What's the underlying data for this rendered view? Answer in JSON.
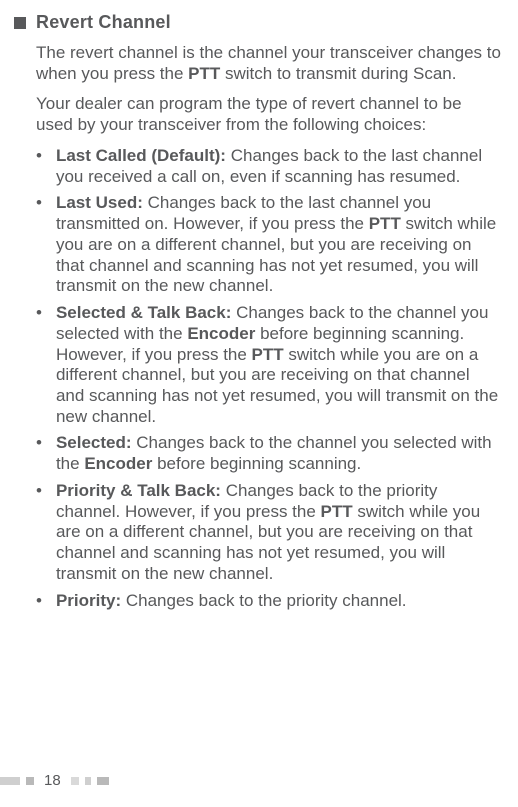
{
  "section": {
    "title": "Revert Channel"
  },
  "intro": {
    "p1_a": "The revert channel is the channel your transceiver changes to when you press the ",
    "p1_b": "PTT",
    "p1_c": " switch to transmit during Scan.",
    "p2": "Your dealer can program the type of revert channel to be used by your transceiver from the following choices:"
  },
  "items": {
    "b0_term": "Last Called (Default):",
    "b0_text": "  Changes back to the last channel you received a call on, even if scanning has resumed.",
    "b1_term": "Last Used:",
    "b1_a": "  Changes back to the last channel you transmitted on.  However, if you press the ",
    "b1_ptt": "PTT",
    "b1_b": " switch while you are on a different channel, but you are receiving on that channel and scanning has not yet resumed, you will transmit on the new channel.",
    "b2_term": "Selected & Talk Back:",
    "b2_a": "  Changes back to the channel you selected with the ",
    "b2_enc": "Encoder",
    "b2_b": " before beginning scanning.  However, if you press the ",
    "b2_ptt": "PTT",
    "b2_c": " switch while you are on a different channel, but you are receiving on that channel and scanning has not yet resumed, you will transmit on the new channel.",
    "b3_term": "Selected:",
    "b3_a": "  Changes back to the channel you selected with the ",
    "b3_enc": "Encoder",
    "b3_b": " before beginning scanning.",
    "b4_term": "Priority & Talk Back:",
    "b4_a": "  Changes back to the priority channel.  However, if you press the ",
    "b4_ptt": "PTT",
    "b4_b": " switch while you are on a different channel, but you are receiving on that channel and scanning has not yet resumed, you will transmit on the new channel.",
    "b5_term": "Priority:",
    "b5_text": "  Changes back to the priority channel."
  },
  "page_number": "18"
}
